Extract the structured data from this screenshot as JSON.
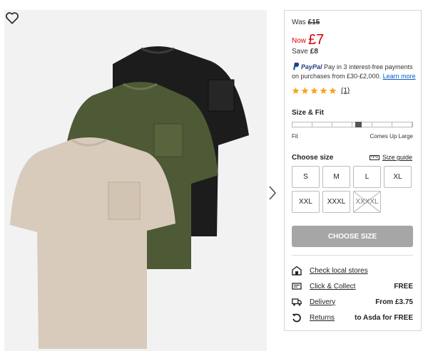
{
  "product": {
    "was_label": "Was",
    "was_price": "£15",
    "now_label": "Now",
    "now_price": "£7",
    "save_label": "Save",
    "save_amount": "£8"
  },
  "paypal": {
    "brand": "PayPal",
    "text_1": "Pay in 3 interest-free payments on purchases from £30-£2,000.",
    "link": "Learn more"
  },
  "rating": {
    "stars": 5,
    "count": "(1)"
  },
  "fit": {
    "title": "Size & Fit",
    "min_label": "Fit",
    "max_label": "Comes Up Large",
    "level": 0.55
  },
  "sizes": {
    "title": "Choose size",
    "guide": "Size guide",
    "options": [
      {
        "label": "S",
        "available": true
      },
      {
        "label": "M",
        "available": true
      },
      {
        "label": "L",
        "available": true
      },
      {
        "label": "XL",
        "available": true
      },
      {
        "label": "XXL",
        "available": true
      },
      {
        "label": "XXXL",
        "available": true
      },
      {
        "label": "XXXXL",
        "available": false
      }
    ]
  },
  "cta": {
    "label": "CHOOSE SIZE"
  },
  "services": [
    {
      "icon": "store-icon",
      "name": "Check local stores",
      "value": ""
    },
    {
      "icon": "collect-icon",
      "name": "Click & Collect",
      "value": "FREE"
    },
    {
      "icon": "truck-icon",
      "name": "Delivery",
      "value": "From £3.75"
    },
    {
      "icon": "return-icon",
      "name": "Returns",
      "value": "to Asda for FREE"
    }
  ],
  "colors": {
    "price_red": "#d50000",
    "star_gold": "#f5a623",
    "cta_grey": "#a6a6a6",
    "tee_black": "#1c1c1c",
    "tee_khaki": "#4e5a35",
    "tee_stone": "#d8cbbb"
  }
}
